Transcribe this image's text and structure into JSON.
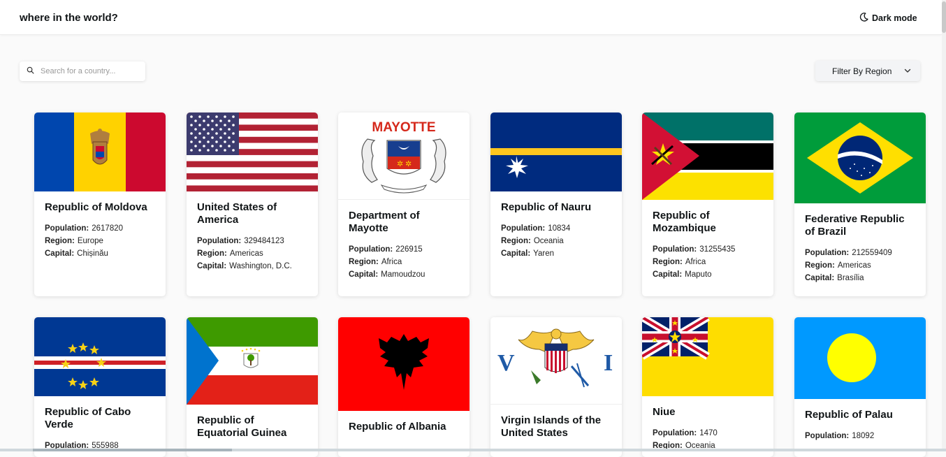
{
  "header": {
    "title": "where in the world?",
    "dark_mode_label": "Dark mode"
  },
  "search": {
    "placeholder": "Search for a country..."
  },
  "filter": {
    "label": "Filter By Region"
  },
  "labels": {
    "population": "Population:",
    "region": "Region:",
    "capital": "Capital:"
  },
  "countries": [
    {
      "name": "Republic of Moldova",
      "population": "2617820",
      "region": "Europe",
      "capital": "Chișinău"
    },
    {
      "name": "United States of America",
      "population": "329484123",
      "region": "Americas",
      "capital": "Washington, D.C."
    },
    {
      "name": "Department of Mayotte",
      "population": "226915",
      "region": "Africa",
      "capital": "Mamoudzou",
      "flag_text": "MAYOTTE"
    },
    {
      "name": "Republic of Nauru",
      "population": "10834",
      "region": "Oceania",
      "capital": "Yaren"
    },
    {
      "name": "Republic of Mozambique",
      "population": "31255435",
      "region": "Africa",
      "capital": "Maputo"
    },
    {
      "name": "Federative Republic of Brazil",
      "population": "212559409",
      "region": "Americas",
      "capital": "Brasília"
    },
    {
      "name": "Republic of Cabo Verde",
      "population": "555988",
      "region": "",
      "capital": ""
    },
    {
      "name": "Republic of Equatorial Guinea",
      "population": "",
      "region": "",
      "capital": ""
    },
    {
      "name": "Republic of Albania",
      "population": "",
      "region": "",
      "capital": ""
    },
    {
      "name": "Virgin Islands of the United States",
      "population": "",
      "region": "",
      "capital": ""
    },
    {
      "name": "Niue",
      "population": "1470",
      "region": "Oceania",
      "capital": ""
    },
    {
      "name": "Republic of Palau",
      "population": "18092",
      "region": "",
      "capital": ""
    }
  ],
  "colors": {
    "background": "#fafafa",
    "card": "#ffffff",
    "text": "#111517"
  },
  "icons": {
    "dark_mode": "moon-icon",
    "search": "search-icon",
    "filter": "chevron-down-icon"
  }
}
